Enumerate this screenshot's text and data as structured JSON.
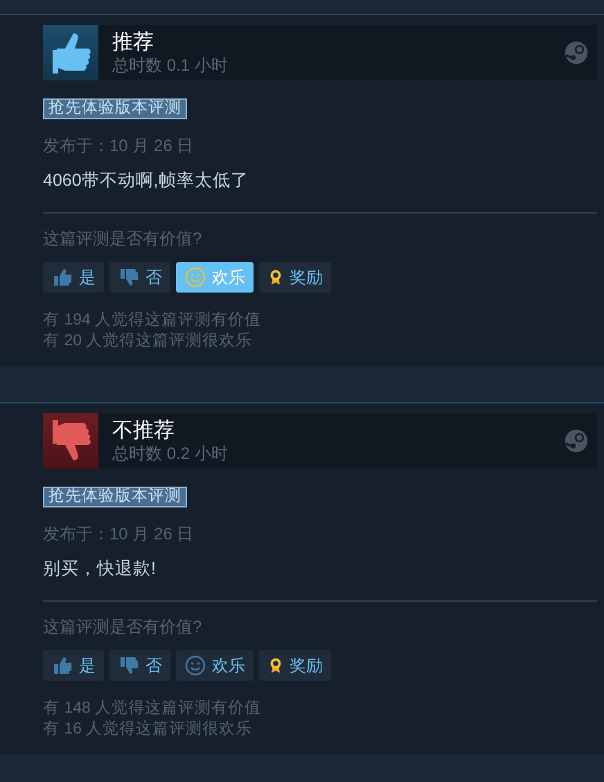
{
  "reviews": [
    {
      "recommended": true,
      "verdict": "推荐",
      "playtime": "总时数 0.1 小时",
      "tag": "抢先体验版本评测",
      "posted": "发布于：10 月 26 日",
      "text": "4060带不动啊,帧率太低了",
      "question": "这篇评测是否有价值?",
      "buttons": [
        {
          "kind": "yes",
          "label": "是",
          "selected": false
        },
        {
          "kind": "no",
          "label": "否",
          "selected": false
        },
        {
          "kind": "funny",
          "label": "欢乐",
          "selected": true
        },
        {
          "kind": "award",
          "label": "奖励",
          "selected": false
        }
      ],
      "counts": [
        "有 194 人觉得这篇评测有价值",
        "有 20 人觉得这篇评测很欢乐"
      ]
    },
    {
      "recommended": false,
      "verdict": "不推荐",
      "playtime": "总时数 0.2 小时",
      "tag": "抢先体验版本评测",
      "posted": "发布于：10 月 26 日",
      "text": "别买，快退款!",
      "question": "这篇评测是否有价值?",
      "buttons": [
        {
          "kind": "yes",
          "label": "是",
          "selected": false
        },
        {
          "kind": "no",
          "label": "否",
          "selected": false
        },
        {
          "kind": "funny",
          "label": "欢乐",
          "selected": false
        },
        {
          "kind": "award",
          "label": "奖励",
          "selected": false
        }
      ],
      "counts": [
        "有 148 人觉得这篇评测有价值",
        "有 16 人觉得这篇评测很欢乐"
      ]
    }
  ]
}
